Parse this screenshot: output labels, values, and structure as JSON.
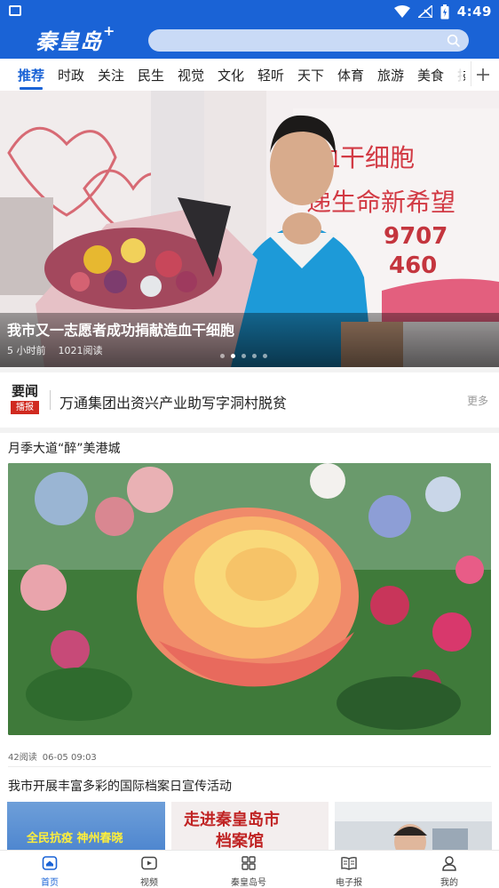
{
  "status_bar": {
    "time": "4:49"
  },
  "header": {
    "logo_text": "秦皇岛",
    "logo_plus": "+",
    "search_placeholder": ""
  },
  "tabs": [
    {
      "label": "推荐",
      "active": true
    },
    {
      "label": "时政"
    },
    {
      "label": "关注"
    },
    {
      "label": "民生"
    },
    {
      "label": "视觉"
    },
    {
      "label": "文化"
    },
    {
      "label": "轻听"
    },
    {
      "label": "天下"
    },
    {
      "label": "体育"
    },
    {
      "label": "旅游"
    },
    {
      "label": "美食"
    },
    {
      "label": "技"
    }
  ],
  "hero": {
    "title": "我市又一志愿者成功捐献造血干细胞",
    "time": "5 小时前",
    "reads": "1021阅读",
    "bg_text_1": "血干细胞",
    "bg_text_2": "递生命新希望",
    "bg_number_1": "9707",
    "bg_number_2": "460",
    "slide_count": 5,
    "active_slide": 1
  },
  "ticker": {
    "badge_top": "要闻",
    "badge_bottom": "播报",
    "headline": "万通集团出资兴产业助写字洞村脱贫",
    "more_label": "更多"
  },
  "article1": {
    "title": "月季大道“醉”美港城",
    "reads": "42阅读",
    "date": "06-05 09:03"
  },
  "article2": {
    "title": "我市开展丰富多彩的国际档案日宣传活动",
    "thumb1_text": "全民抗疫 神州春晓",
    "thumb2_text": "走进秦皇岛市",
    "thumb2_text_2": "档案馆"
  },
  "bottom_nav": [
    {
      "label": "首页",
      "icon": "home-icon",
      "active": true
    },
    {
      "label": "视频",
      "icon": "video-icon"
    },
    {
      "label": "秦皇岛号",
      "icon": "grid-icon"
    },
    {
      "label": "电子报",
      "icon": "newspaper-icon"
    },
    {
      "label": "我的",
      "icon": "user-icon"
    }
  ],
  "colors": {
    "brand": "#1a63d6",
    "badge_red": "#d02a20"
  }
}
